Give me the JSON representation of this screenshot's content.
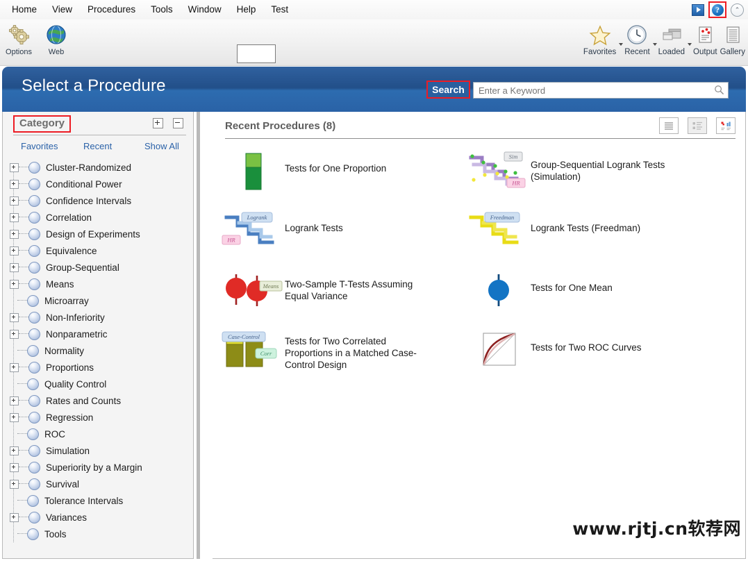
{
  "menubar": {
    "items": [
      {
        "label": "Home"
      },
      {
        "label": "View"
      },
      {
        "label": "Procedures"
      },
      {
        "label": "Tools"
      },
      {
        "label": "Window"
      },
      {
        "label": "Help"
      },
      {
        "label": "Test"
      }
    ],
    "help_glyph": "?",
    "collapse_glyph": "⌃"
  },
  "ribbon": {
    "left": [
      {
        "label": "Options",
        "icon": "gears-icon"
      },
      {
        "label": "Web",
        "icon": "globe-icon"
      }
    ],
    "right": [
      {
        "label": "Favorites",
        "icon": "star-icon",
        "has_caret": true
      },
      {
        "label": "Recent",
        "icon": "clock-icon",
        "has_caret": true
      },
      {
        "label": "Loaded",
        "icon": "windows-icon",
        "has_caret": true
      },
      {
        "label": "Output",
        "icon": "output-report-icon",
        "has_caret": false
      },
      {
        "label": "Gallery",
        "icon": "gallery-lines-icon",
        "has_caret": false
      }
    ]
  },
  "header": {
    "title": "Select a Procedure",
    "search_label": "Search",
    "search_placeholder": "Enter a Keyword",
    "search_value": "",
    "accent_blue": "#27589a",
    "highlight_red": "#ed1c24"
  },
  "sidebar": {
    "title": "Category",
    "expand_all_icon": "expand-all-icon",
    "collapse_all_icon": "collapse-all-icon",
    "tabs": [
      {
        "label": "Favorites"
      },
      {
        "label": "Recent"
      },
      {
        "label": "Show All"
      }
    ],
    "tree": [
      {
        "label": "Cluster-Randomized",
        "expandable": true
      },
      {
        "label": "Conditional Power",
        "expandable": true
      },
      {
        "label": "Confidence Intervals",
        "expandable": true
      },
      {
        "label": "Correlation",
        "expandable": true
      },
      {
        "label": "Design of Experiments",
        "expandable": true
      },
      {
        "label": "Equivalence",
        "expandable": true
      },
      {
        "label": "Group-Sequential",
        "expandable": true
      },
      {
        "label": "Means",
        "expandable": true
      },
      {
        "label": "Microarray",
        "expandable": false
      },
      {
        "label": "Non-Inferiority",
        "expandable": true
      },
      {
        "label": "Nonparametric",
        "expandable": true
      },
      {
        "label": "Normality",
        "expandable": false
      },
      {
        "label": "Proportions",
        "expandable": true
      },
      {
        "label": "Quality Control",
        "expandable": false
      },
      {
        "label": "Rates and Counts",
        "expandable": true
      },
      {
        "label": "Regression",
        "expandable": true
      },
      {
        "label": "ROC",
        "expandable": false
      },
      {
        "label": "Simulation",
        "expandable": true
      },
      {
        "label": "Superiority by a Margin",
        "expandable": true
      },
      {
        "label": "Survival",
        "expandable": true
      },
      {
        "label": "Tolerance Intervals",
        "expandable": false
      },
      {
        "label": "Variances",
        "expandable": true
      },
      {
        "label": "Tools",
        "expandable": false
      }
    ]
  },
  "main": {
    "title": "Recent Procedures (8)",
    "view_modes": [
      {
        "name": "list-view-icon",
        "selected": false
      },
      {
        "name": "detail-view-icon",
        "selected": true
      },
      {
        "name": "icon-view-icon",
        "selected": false
      }
    ],
    "procedures": [
      {
        "label": "Tests for One Proportion",
        "icon": "green-bar-proportion-icon",
        "lines": 1
      },
      {
        "label": "Group-Sequential Logrank Tests (Simulation)",
        "icon": "purple-staircase-sim-icon",
        "lines": 2
      },
      {
        "label": "Logrank Tests",
        "icon": "blue-staircase-logrank-icon",
        "lines": 1
      },
      {
        "label": "Logrank Tests (Freedman)",
        "icon": "yellow-staircase-freedman-icon",
        "lines": 1
      },
      {
        "label": "Two-Sample T-Tests Assuming Equal Variance",
        "icon": "red-two-means-icon",
        "lines": 2
      },
      {
        "label": "Tests for One Mean",
        "icon": "blue-one-mean-icon",
        "lines": 1
      },
      {
        "label": "Tests for Two Correlated Proportions in a Matched Case-Control Design",
        "icon": "olive-case-control-icon",
        "lines": 3
      },
      {
        "label": "Tests for Two ROC Curves",
        "icon": "roc-curve-icon",
        "lines": 1
      }
    ],
    "icon_badges": {
      "sim": "Sim",
      "hr": "HR",
      "logrank": "Logrank",
      "freedman": "Freedman",
      "means": "Means",
      "case_control": "Case-Control",
      "corr": "Corr"
    }
  },
  "watermark": {
    "text": "www.rjtj.cn软荐网"
  }
}
